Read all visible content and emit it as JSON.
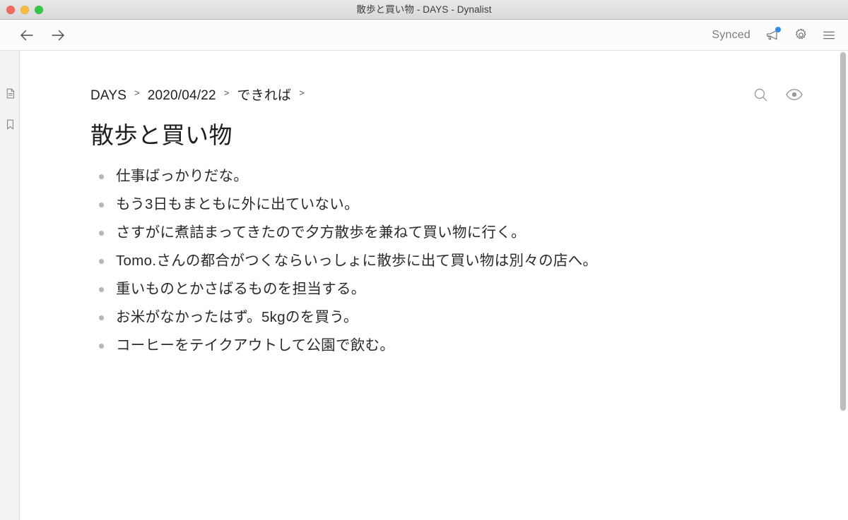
{
  "window": {
    "title": "散歩と買い物 - DAYS - Dynalist",
    "traffic_lights": {
      "close_label": "close",
      "minimize_label": "minimize",
      "maximize_label": "maximize"
    }
  },
  "toolbar": {
    "back_icon": "arrow-left-icon",
    "forward_icon": "arrow-right-icon",
    "sync_status": "Synced",
    "announcement_icon": "megaphone-icon",
    "has_notification": true,
    "settings_icon": "gear-icon",
    "menu_icon": "hamburger-menu-icon"
  },
  "sidebar": {
    "items": [
      {
        "icon": "document-icon",
        "label": "Documents"
      },
      {
        "icon": "bookmark-icon",
        "label": "Bookmarks"
      }
    ]
  },
  "breadcrumb": {
    "separator": ">",
    "items": [
      {
        "label": "DAYS"
      },
      {
        "label": "2020/04/22"
      },
      {
        "label": "できれば"
      }
    ]
  },
  "content_tools": {
    "search_icon": "search-icon",
    "visibility_icon": "eye-icon"
  },
  "document": {
    "title": "散歩と買い物",
    "items": [
      {
        "text": "仕事ばっかりだな。"
      },
      {
        "text": "もう3日もまともに外に出ていない。"
      },
      {
        "text": "さすがに煮詰まってきたので夕方散歩を兼ねて買い物に行く。"
      },
      {
        "text": "Tomo.さんの都合がつくならいっしょに散歩に出て買い物は別々の店へ。"
      },
      {
        "text": "重いものとかさばるものを担当する。"
      },
      {
        "text": "お米がなかったはず。5kgのを買う。"
      },
      {
        "text": "コーヒーをテイクアウトして公園で飲む。"
      }
    ]
  },
  "colors": {
    "titlebar_bg": "#e2e2e2",
    "toolbar_bg": "#fcfcfc",
    "sidebar_bg": "#f3f3f3",
    "content_bg": "#ffffff",
    "text": "#2a2a2a",
    "muted": "#9a9a9a",
    "notification_dot": "#2b8ded",
    "bullet": "#b6b6b6",
    "scrollbar_thumb": "#bdbdbd"
  }
}
